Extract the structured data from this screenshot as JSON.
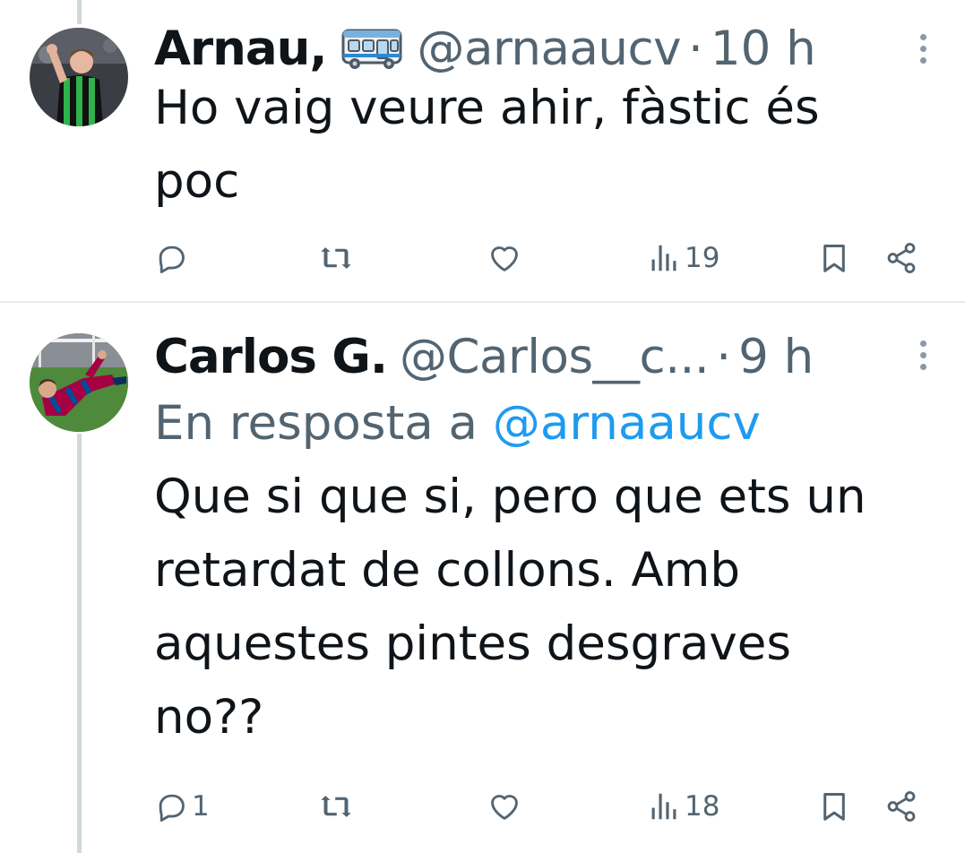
{
  "tweets": [
    {
      "author_name": "Arnau",
      "author_suffix": " ,",
      "emoji_icon": "bus-icon",
      "handle": "@arnaaucv",
      "separator": "·",
      "time": "10 h",
      "text": "Ho vaig veure ahir, fàstic és\npoc",
      "actions": {
        "reply_count": "",
        "retweet_count": "",
        "like_count": "",
        "views_count": "19"
      }
    },
    {
      "author_name": "Carlos G.",
      "handle": "@Carlos__c...",
      "separator": "·",
      "time": "9 h",
      "reply_prefix": "En resposta a ",
      "reply_mention": "@arnaaucv",
      "text": "Que si que si, pero que ets un\nretardat de collons. Amb\naquestes pintes desgraves\nno??",
      "actions": {
        "reply_count": "1",
        "retweet_count": "",
        "like_count": "",
        "views_count": "18"
      }
    }
  ],
  "colors": {
    "primary_text": "#0f1419",
    "secondary_text": "#536471",
    "link": "#1d9bf0",
    "thread_line": "#cfd9de",
    "divider": "#e6ecf0"
  },
  "icons": [
    "reply-icon",
    "retweet-icon",
    "like-icon",
    "views-icon",
    "bookmark-icon",
    "share-icon",
    "more-icon",
    "bus-icon"
  ]
}
